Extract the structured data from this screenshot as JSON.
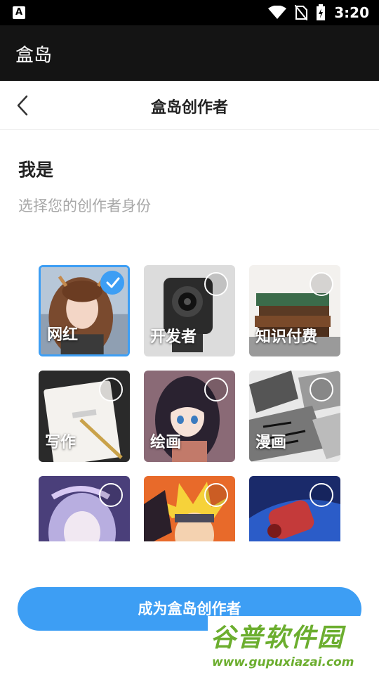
{
  "status_bar": {
    "app_icon_letter": "A",
    "time": "3:20"
  },
  "app_bar": {
    "title": "盒岛"
  },
  "header": {
    "title": "盒岛创作者"
  },
  "section": {
    "title": "我是",
    "subtitle": "选择您的创作者身份"
  },
  "cards": [
    {
      "label": "网红",
      "selected": true
    },
    {
      "label": "开发者",
      "selected": false
    },
    {
      "label": "知识付费",
      "selected": false
    },
    {
      "label": "写作",
      "selected": false
    },
    {
      "label": "绘画",
      "selected": false
    },
    {
      "label": "漫画",
      "selected": false
    },
    {
      "label": "",
      "selected": false
    },
    {
      "label": "",
      "selected": false
    },
    {
      "label": "",
      "selected": false
    }
  ],
  "primary_button": {
    "label": "成为盒岛创作者"
  },
  "watermark": {
    "title": "谷普软件园",
    "url": "www.gupuxiazai.com"
  },
  "colors": {
    "accent": "#3d9ef4",
    "app_bar": "#141414",
    "status_bar": "#000000"
  }
}
